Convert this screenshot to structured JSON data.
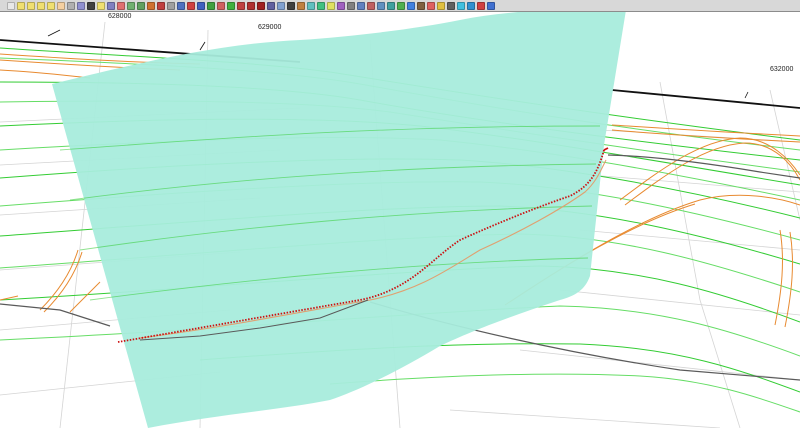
{
  "app": {
    "view": "3D perspective view"
  },
  "toolbar": {
    "buttons": [
      {
        "icon": "new-file-icon",
        "color": "#e8e8e8"
      },
      {
        "icon": "zoom-in-icon",
        "color": "#f0e070"
      },
      {
        "icon": "zoom-out-icon",
        "color": "#f0e070"
      },
      {
        "icon": "zoom-window-icon",
        "color": "#f0e070"
      },
      {
        "icon": "zoom-extents-icon",
        "color": "#f0e070"
      },
      {
        "icon": "pan-hand-icon",
        "color": "#f5d0a0"
      },
      {
        "icon": "rotate-icon",
        "color": "#b0b0b0"
      },
      {
        "icon": "undo-view-icon",
        "color": "#9090d0"
      },
      {
        "icon": "pointer-icon",
        "color": "#404040"
      },
      {
        "icon": "help-icon",
        "color": "#f0e070"
      },
      {
        "icon": "layer-icon",
        "color": "#8080c0"
      },
      {
        "icon": "palette-icon",
        "color": "#e07070"
      },
      {
        "icon": "grid-icon",
        "color": "#70b070"
      },
      {
        "icon": "checker-icon",
        "color": "#60a060"
      },
      {
        "icon": "surface-icon",
        "color": "#d07030"
      },
      {
        "icon": "triangle-icon",
        "color": "#c04040"
      },
      {
        "icon": "print-icon",
        "color": "#a0a0a0"
      },
      {
        "icon": "pencil-icon",
        "color": "#5070c0"
      },
      {
        "icon": "curve-icon",
        "color": "#d04040"
      },
      {
        "icon": "arc-icon",
        "color": "#4060c0"
      },
      {
        "icon": "polyline-icon",
        "color": "#40a040"
      },
      {
        "icon": "spline-icon",
        "color": "#d06060"
      },
      {
        "icon": "contour-icon",
        "color": "#40b040"
      },
      {
        "icon": "profile-icon",
        "color": "#c04040"
      },
      {
        "icon": "section-icon",
        "color": "#b03030"
      },
      {
        "icon": "cross-section-icon",
        "color": "#a02020"
      },
      {
        "icon": "breakline-icon",
        "color": "#6060a0"
      },
      {
        "icon": "boundary-icon",
        "color": "#80a0d0"
      },
      {
        "icon": "text-label-icon",
        "color": "#404040"
      },
      {
        "icon": "measure-icon",
        "color": "#c08040"
      },
      {
        "icon": "volume-icon",
        "color": "#60c0c0"
      },
      {
        "icon": "shade-icon",
        "color": "#40c080"
      },
      {
        "icon": "light-icon",
        "color": "#e0e060"
      },
      {
        "icon": "layers-stack-icon",
        "color": "#a060c0"
      },
      {
        "icon": "settings-icon",
        "color": "#808080"
      },
      {
        "icon": "table-icon",
        "color": "#6080c0"
      },
      {
        "icon": "export-icon",
        "color": "#c06060"
      },
      {
        "icon": "import-icon",
        "color": "#6090c0"
      },
      {
        "icon": "model-icon",
        "color": "#40a0a0"
      },
      {
        "icon": "terrain-icon",
        "color": "#50b050"
      },
      {
        "icon": "water-icon",
        "color": "#4080e0"
      },
      {
        "icon": "road-icon",
        "color": "#806040"
      },
      {
        "icon": "color-ramp-icon",
        "color": "#e06060"
      },
      {
        "icon": "legend-icon",
        "color": "#e0c040"
      },
      {
        "icon": "camera-icon",
        "color": "#606060"
      },
      {
        "icon": "animate-icon",
        "color": "#40c0e0"
      },
      {
        "icon": "globe-icon",
        "color": "#3090d0"
      },
      {
        "icon": "target-icon",
        "color": "#d04040"
      },
      {
        "icon": "info-icon",
        "color": "#4070d0"
      }
    ]
  },
  "grid_labels": [
    {
      "text": "628000"
    },
    {
      "text": "629000"
    },
    {
      "text": "632000"
    }
  ],
  "colors": {
    "plane_fill": "#a8ecdc",
    "contour_major": "#33cc33",
    "contour_minor": "#66dd66",
    "orange_lines": "#e88a30",
    "tan_line": "#e0a070",
    "road_gray": "#5a5a5a",
    "profile_red": "#cc1111",
    "grid_gray": "#d4d4d4",
    "axis_black": "#111111"
  }
}
